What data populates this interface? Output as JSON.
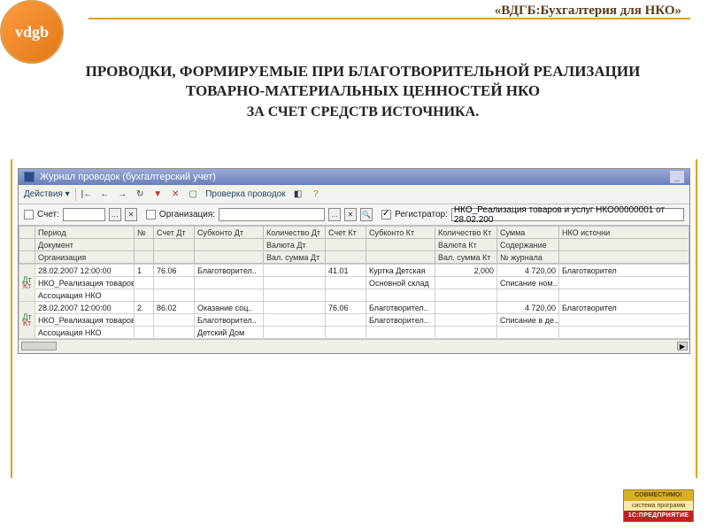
{
  "brand": "«ВДГБ:Бухгалтерия для НКО»",
  "logo_text": "vdgb",
  "headline1": "ПРОВОДКИ, ФОРМИРУЕМЫЕ ПРИ БЛАГОТВОРИТЕЛЬНОЙ РЕАЛИЗАЦИИ ТОВАРНО-МАТЕРИАЛЬНЫХ ЦЕННОСТЕЙ НКО",
  "headline2": "ЗА СЧЕТ СРЕДСТВ ИСТОЧНИКА.",
  "window": {
    "title": "Журнал проводок (бухгалтерский учет)",
    "minimize": "_"
  },
  "toolbar": {
    "actions": "Действия ▾",
    "check": "Проверка проводок",
    "help": "?"
  },
  "filter": {
    "acct_label": "Счет:",
    "acct_value": "",
    "org_label": "Организация:",
    "org_value": "",
    "reg_label": "Регистратор:",
    "reg_value": "НКО_Реализация товаров и услуг НКО00000001 от 28.02.200"
  },
  "headers": {
    "r1": [
      "",
      "Период",
      "№",
      "Счет Дт",
      "Субконто Дт",
      "Количество Дт",
      "Счет Кт",
      "Субконто Кт",
      "Количество Кт",
      "Сумма",
      "НКО источни"
    ],
    "r2": [
      "",
      "Документ",
      "",
      "",
      "",
      "Валюта Дт",
      "",
      "",
      "Валюта Кт",
      "Содержание",
      ""
    ],
    "r3": [
      "",
      "Организация",
      "",
      "",
      "",
      "Вал. сумма Дт",
      "",
      "",
      "Вал. сумма Кт",
      "№ журнала",
      ""
    ]
  },
  "rows": [
    {
      "marker": true,
      "r1": [
        "28.02.2007 12:00:00",
        "1",
        "76.06",
        "Благотворител..",
        "",
        "41.01",
        "Куртка Детская",
        "2,000",
        "4 720,00",
        "Благотворител"
      ],
      "r2": [
        "НКО_Реализация товаров..",
        "",
        "",
        "",
        "",
        "",
        "Основной склад",
        "",
        "Списание ном..",
        ""
      ],
      "r3": [
        "Ассоциация НКО",
        "",
        "",
        "",
        "",
        "",
        "",
        "",
        "",
        ""
      ]
    },
    {
      "marker": true,
      "r1": [
        "28.02.2007 12:00:00",
        "2",
        "86.02",
        "Оказание соц..",
        "",
        "76.06",
        "Благотворител..",
        "",
        "4 720,00",
        "Благотворител"
      ],
      "r2": [
        "НКО_Реализация товаров..",
        "",
        "",
        "Благотворител..",
        "",
        "",
        "Благотворител..",
        "",
        "Списание в де..",
        ""
      ],
      "r3": [
        "Ассоциация НКО",
        "",
        "",
        "Детский Дом",
        "",
        "",
        "",
        "",
        "",
        ""
      ]
    }
  ],
  "badge": {
    "top": "СОВМЕСТИМО!",
    "mid": "система программ",
    "bot": "1С:ПРЕДПРИЯТИЕ"
  }
}
